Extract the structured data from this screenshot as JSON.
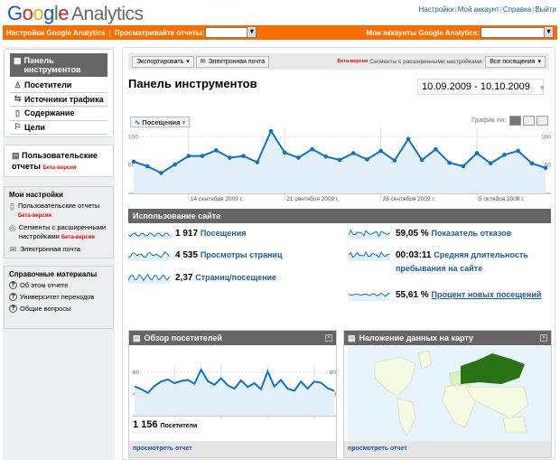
{
  "header": {
    "logo": "Google Analytics",
    "links": [
      "Настройки",
      "Мой аккаунт",
      "Справка",
      "Выйти"
    ]
  },
  "orange_bar": {
    "settings": "Настройки Google Analytics",
    "view_reports": "Просматривайте отчеты:",
    "my_accounts": "Мои аккаунты Google Analytics:"
  },
  "sidebar": {
    "nav": [
      {
        "label": "Панель инструментов",
        "icon": "dashboard-icon",
        "active": true
      },
      {
        "label": "Посетители",
        "icon": "person-icon"
      },
      {
        "label": "Источники трафика",
        "icon": "traffic-icon"
      },
      {
        "label": "Содержание",
        "icon": "page-icon"
      },
      {
        "label": "Цели",
        "icon": "flag-icon"
      }
    ],
    "custom_reports": "Пользовательские отчеты",
    "beta": "Бета-версия",
    "my_settings": {
      "title": "Мои настройки",
      "items": [
        {
          "label": "Пользовательские отчеты",
          "beta": "Бета-версия"
        },
        {
          "label": "Сегменты с расширенными настройками",
          "beta": "Бета-версия"
        },
        {
          "label": "Электронная почта"
        }
      ]
    },
    "help": {
      "title": "Справочные материалы",
      "items": [
        "Об этом отчете",
        "Университет переходов",
        "Общие вопросы"
      ]
    }
  },
  "toolbar": {
    "export": "Экспортировать",
    "email": "Электронная почта",
    "beta": "Бета-версия",
    "segments_label": "Сегменты с расширенными настройками:",
    "segment_value": "Все посещения"
  },
  "page_title": "Панель инструментов",
  "date_range": "10.09.2009 - 10.10.2009",
  "metric_selector": "Посещения",
  "graph_by": "График по:",
  "chart_data": [
    {
      "type": "area",
      "series": [
        {
          "name": "Посещения",
          "values": [
            56,
            48,
            36,
            51,
            66,
            66,
            76,
            63,
            66,
            55,
            110,
            72,
            63,
            78,
            65,
            59,
            71,
            60,
            75,
            58,
            96,
            59,
            78,
            54,
            48,
            71,
            53,
            68,
            75,
            53,
            45
          ]
        }
      ],
      "ylim": [
        0,
        110
      ],
      "yticks": [
        50,
        100
      ],
      "xtick_labels": [
        "14 сентября 2009 г.",
        "21 сентября 2009 г.",
        "28 сентября 2009 г.",
        "5 октября 2009 г."
      ],
      "x_range": [
        "10.09.2009",
        "10.10.2009"
      ],
      "grid": true
    },
    {
      "type": "area",
      "series": [
        {
          "name": "Посетители",
          "values": [
            54,
            49,
            42,
            55,
            63,
            67,
            60,
            64,
            66,
            59,
            85,
            64,
            57,
            69,
            56,
            50,
            65,
            53,
            60,
            49,
            82,
            54,
            66,
            50,
            46,
            63,
            50,
            63,
            61,
            51,
            46
          ]
        }
      ],
      "ylim": [
        0,
        90
      ],
      "yticks": [
        40,
        80
      ],
      "grid": true
    }
  ],
  "site_usage": {
    "title": "Использование сайта",
    "metrics": [
      {
        "value": "1 917",
        "label": "Посещения"
      },
      {
        "value": "4 535",
        "label": "Просмотры страниц"
      },
      {
        "value": "2,37",
        "label": "Страниц/посещение"
      },
      {
        "value": "59,05 %",
        "label": "Показатель отказов"
      },
      {
        "value": "00:03:11",
        "label": "Средняя длительность пребывания на сайте"
      },
      {
        "value": "55,61 %",
        "label": "Процент новых посещений"
      }
    ]
  },
  "visitors_panel": {
    "title": "Обзор посетителей",
    "count": "1 156",
    "count_label": "Посетители",
    "link": "просмотреть отчет"
  },
  "map_panel": {
    "title": "Наложение данных на карту",
    "link": "просмотреть отчет"
  },
  "colors": {
    "orange": "#f76f00",
    "line": "#0e73c7",
    "fill": "#e3f0fa",
    "header_gray": "#666666",
    "map_highlight": "#2a7314"
  }
}
